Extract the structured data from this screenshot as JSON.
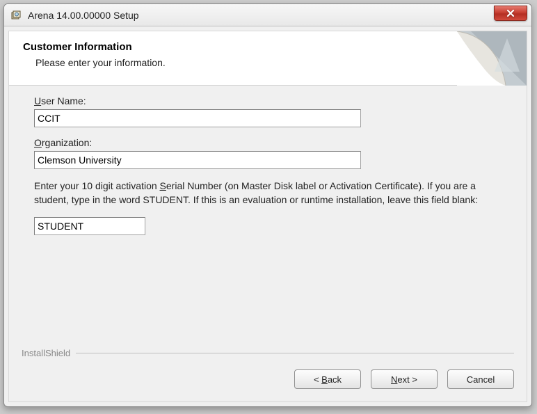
{
  "window": {
    "title": "Arena 14.00.00000  Setup"
  },
  "header": {
    "title": "Customer Information",
    "subtitle": "Please enter your information."
  },
  "form": {
    "user_label_pre": "",
    "user_label_ul": "U",
    "user_label_post": "ser Name:",
    "user_value": "CCIT",
    "org_label_pre": "",
    "org_label_ul": "O",
    "org_label_post": "rganization:",
    "org_value": "Clemson University",
    "serial_instr_a": "Enter your 10 digit activation ",
    "serial_instr_ul": "S",
    "serial_instr_b": "erial Number (on Master Disk label or Activation Certificate).  If you are a student, type in the word STUDENT.  If this is an evaluation or runtime installation, leave this field blank:",
    "serial_value": "STUDENT"
  },
  "footer": {
    "brand": "InstallShield",
    "back_pre": "< ",
    "back_ul": "B",
    "back_post": "ack",
    "next_pre": "",
    "next_ul": "N",
    "next_post": "ext >",
    "cancel": "Cancel"
  }
}
